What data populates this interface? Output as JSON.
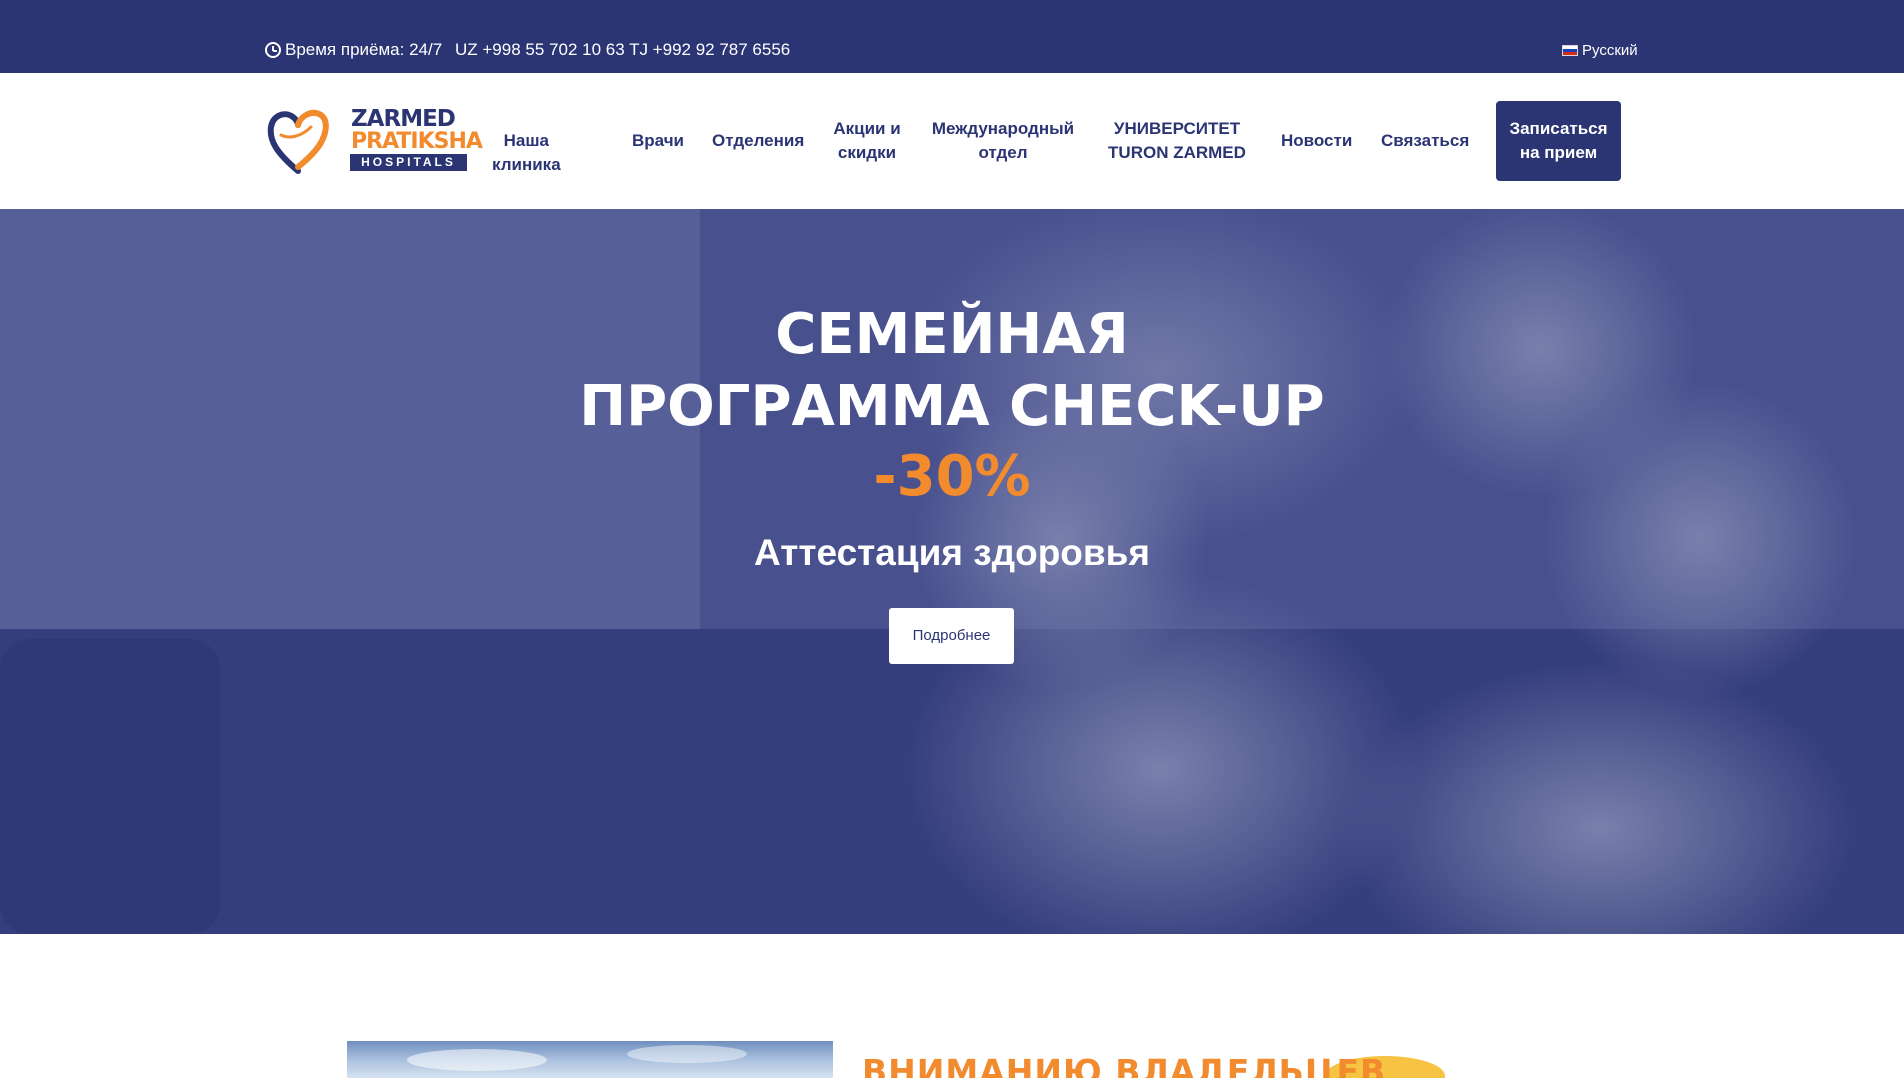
{
  "topbar": {
    "hours": "Время приёма: 24/7",
    "phones": "UZ +998 55 702 10 63 TJ +992 92 787 6556",
    "language": "Русский"
  },
  "logo": {
    "line1": "ZARMED",
    "line2": "PRATIKSHA",
    "line3": "HOSPITALS"
  },
  "nav": {
    "items": [
      {
        "label": "Наша клиника"
      },
      {
        "label": "Врачи"
      },
      {
        "label": "Отделения"
      },
      {
        "label": "Акции и скидки"
      },
      {
        "label": "Международный отдел"
      },
      {
        "label": "УНИВЕРСИТЕТ TURON ZARMED"
      },
      {
        "label": "Новости"
      },
      {
        "label": "Связаться"
      }
    ],
    "cta": "Записаться на прием"
  },
  "hero": {
    "title_line1": "СЕМЕЙНАЯ",
    "title_line2": "ПРОГРАММА CHECK-UP",
    "discount": "-30%",
    "subtitle": "Аттестация здоровья",
    "button": "Подробнее"
  },
  "notice": {
    "heading": "ВНИМАНИЮ ВЛАДЕЛЬЦЕВ"
  },
  "colors": {
    "brand": "#2b3574",
    "accent": "#f28a2e"
  }
}
